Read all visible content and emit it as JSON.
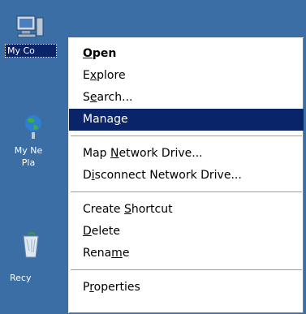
{
  "desktop": {
    "background_color": "#3a6ea5",
    "icons": [
      {
        "label": "My Co",
        "icon": "my-computer-icon",
        "selected": true
      },
      {
        "label": "My Ne\nPla",
        "icon": "network-places-icon",
        "selected": false
      },
      {
        "label": "Recy",
        "icon": "recycle-bin-icon",
        "selected": false
      }
    ]
  },
  "context_menu": {
    "highlight_color": "#0a246a",
    "items": [
      {
        "pre": "",
        "ul": "O",
        "post": "pen",
        "bold": true
      },
      {
        "pre": "E",
        "ul": "x",
        "post": "plore"
      },
      {
        "pre": "S",
        "ul": "e",
        "post": "arch..."
      },
      {
        "pre": "Mana",
        "ul": "g",
        "post": "e",
        "highlighted": true
      },
      {
        "pre": "Map ",
        "ul": "N",
        "post": "etwork Drive..."
      },
      {
        "pre": "D",
        "ul": "i",
        "post": "sconnect Network Drive..."
      },
      {
        "pre": "Create ",
        "ul": "S",
        "post": "hortcut"
      },
      {
        "pre": "",
        "ul": "D",
        "post": "elete"
      },
      {
        "pre": "Rena",
        "ul": "m",
        "post": "e"
      },
      {
        "pre": "P",
        "ul": "r",
        "post": "operties"
      }
    ]
  }
}
